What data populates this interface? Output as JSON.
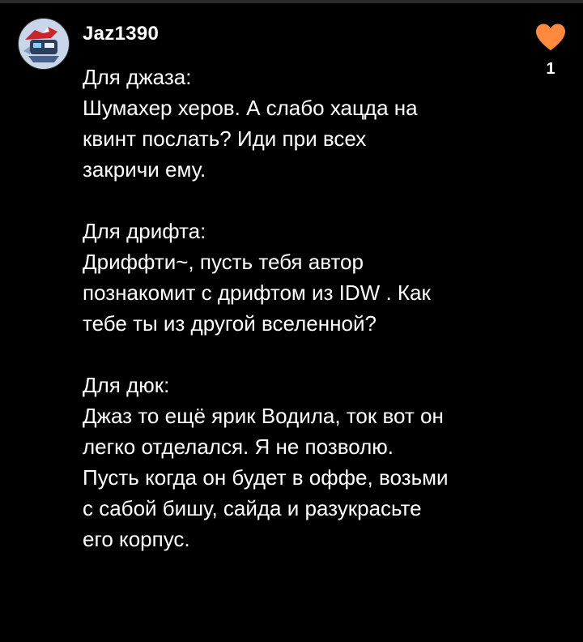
{
  "comment": {
    "username": "Jaz1390",
    "like_count": "1",
    "paragraphs": [
      {
        "lines": [
          "Для джаза:",
          "Шумахер херов. А слабо хацда на",
          "квинт послать? Иди при всех",
          "закричи ему."
        ]
      },
      {
        "lines": [
          "Для дрифта:",
          "Дриффти~, пусть тебя автор",
          "познакомит с дрифтом из IDW . Как",
          "тебе ты из другой вселенной?"
        ]
      },
      {
        "lines": [
          "Для дюк:",
          "Джаз то ещё ярик Водила, ток вот он",
          "легко отделался. Я не позволю.",
          "Пусть когда он будет в оффе, возьми",
          "с сабой бишу, сайда и разукрасьте",
          "его корпус."
        ]
      }
    ],
    "like_color": "#ff8a3d",
    "avatar_icon": "robot-avatar-icon"
  }
}
